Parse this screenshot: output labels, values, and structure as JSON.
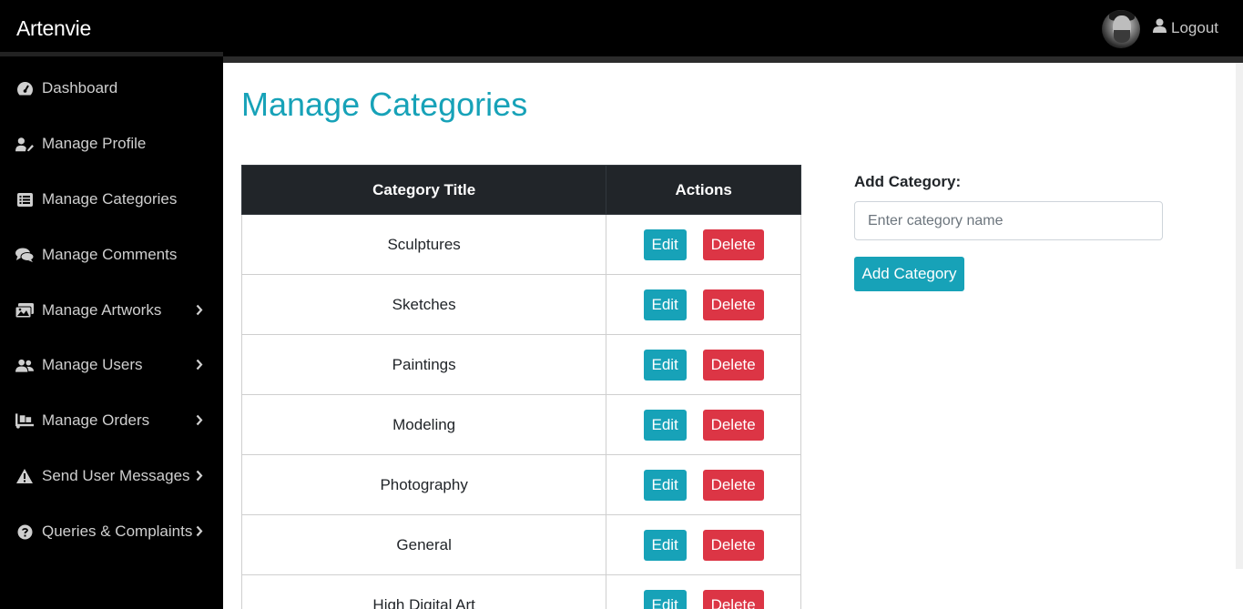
{
  "app": {
    "brand": "Artenvie"
  },
  "header": {
    "logout_label": "Logout"
  },
  "sidebar": {
    "items": [
      {
        "label": "Dashboard",
        "icon": "tachometer-icon",
        "has_chevron": false
      },
      {
        "label": "Manage Profile",
        "icon": "user-edit-icon",
        "has_chevron": false
      },
      {
        "label": "Manage Categories",
        "icon": "list-alt-icon",
        "has_chevron": false
      },
      {
        "label": "Manage Comments",
        "icon": "comments-icon",
        "has_chevron": false
      },
      {
        "label": "Manage Artworks",
        "icon": "images-icon",
        "has_chevron": true
      },
      {
        "label": "Manage Users",
        "icon": "users-icon",
        "has_chevron": true
      },
      {
        "label": "Manage Orders",
        "icon": "dolly-icon",
        "has_chevron": true
      },
      {
        "label": "Send User Messages",
        "icon": "warning-icon",
        "has_chevron": true
      },
      {
        "label": "Queries & Complaints",
        "icon": "question-circle-icon",
        "has_chevron": true
      }
    ]
  },
  "main": {
    "title": "Manage Categories",
    "table": {
      "headers": [
        "Category Title",
        "Actions"
      ],
      "edit_label": "Edit",
      "delete_label": "Delete",
      "rows": [
        "Sculptures",
        "Sketches",
        "Paintings",
        "Modeling",
        "Photography",
        "General",
        "High Digital Art"
      ]
    },
    "add_form": {
      "label": "Add Category:",
      "placeholder": "Enter category name",
      "value": "",
      "button_label": "Add Category"
    }
  },
  "colors": {
    "accent": "#17a2b8",
    "danger": "#dc3545",
    "sidebar_bg": "#000000",
    "table_header_bg": "#212529"
  }
}
